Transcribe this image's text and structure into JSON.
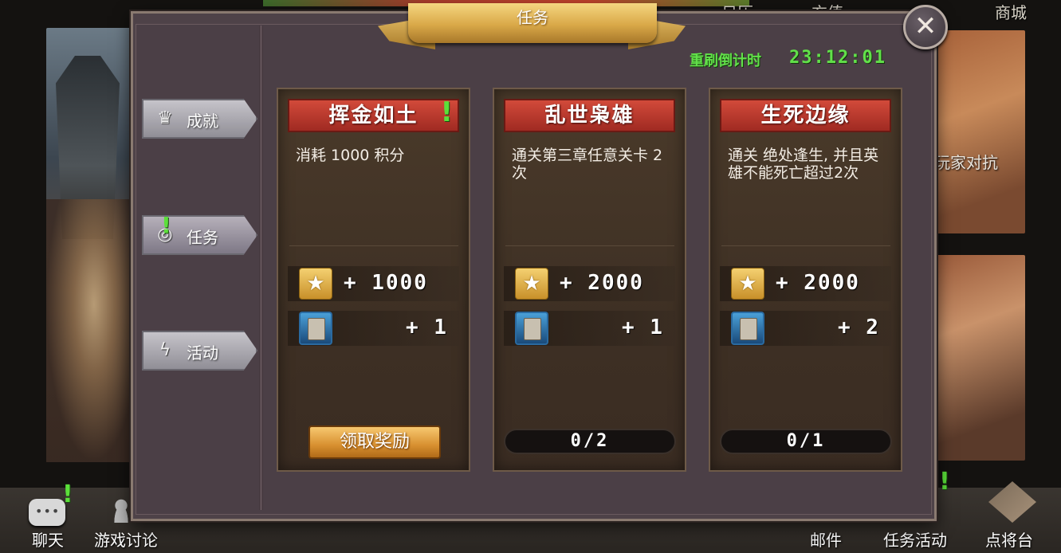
{
  "background": {
    "right_panel_label": "玩家对抗",
    "top_labels": [
      "日历",
      "充值",
      "商城"
    ]
  },
  "bottom_bar": {
    "chat": "聊天",
    "forum": "游戏讨论",
    "mail": "邮件",
    "quests": "任务活动",
    "generals": "点将台"
  },
  "dialog": {
    "title": "任务",
    "close_icon": "close-icon",
    "countdown_label": "重刷倒计时",
    "countdown_value": "23:12:01"
  },
  "tabs": [
    {
      "label": "成就",
      "icon": "crown-icon",
      "active": false,
      "alert": false
    },
    {
      "label": "任务",
      "icon": "eye-icon",
      "active": true,
      "alert": true
    },
    {
      "label": "活动",
      "icon": "lightning-icon",
      "active": false,
      "alert": false
    }
  ],
  "quests": [
    {
      "title": "挥金如土",
      "alert": true,
      "description": "消耗 1000 积分",
      "rewards": [
        {
          "icon": "star-icon",
          "value": "+ 1000"
        },
        {
          "icon": "card-icon",
          "value": "+ 1"
        }
      ],
      "status_type": "button",
      "status": "领取奖励"
    },
    {
      "title": "乱世枭雄",
      "alert": false,
      "description": "通关第三章任意关卡 2 次",
      "rewards": [
        {
          "icon": "star-icon",
          "value": "+ 2000"
        },
        {
          "icon": "card-icon",
          "value": "+ 1"
        }
      ],
      "status_type": "progress",
      "status": "0/2",
      "progress": 0
    },
    {
      "title": "生死边缘",
      "alert": false,
      "description": "通关 绝处逢生, 并且英雄不能死亡超过2次",
      "rewards": [
        {
          "icon": "star-icon",
          "value": "+ 2000"
        },
        {
          "icon": "card-icon",
          "value": "+ 2"
        }
      ],
      "status_type": "progress",
      "status": "0/1",
      "progress": 0
    }
  ]
}
